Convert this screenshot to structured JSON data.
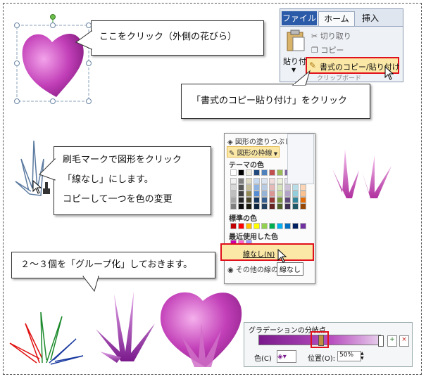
{
  "callouts": {
    "click_outer_petal": "ここをクリック（外側の花びら）",
    "click_format_painter": "「書式のコピー貼り付け」をクリック",
    "brush_line1": "刷毛マークで図形をクリック",
    "brush_line2": "「線なし」にします。",
    "brush_line3": "コピーして一つを色の変更",
    "group_note": "２～３個を「グループ化」しておきます。"
  },
  "ribbon": {
    "tab_file": "ファイル",
    "tab_home": "ホーム",
    "tab_insert": "挿入",
    "paste_label": "貼り付け",
    "cut_label": "切り取り",
    "copy_label": "コピー",
    "format_painter_label": "書式のコピー/貼り付け",
    "clipboard_label": "クリップボード"
  },
  "palette": {
    "shape_fill": "図形の塗りつぶし",
    "shape_outline": "図形の枠線",
    "theme_colors": "テーマの色",
    "standard_colors": "標準の色",
    "recent_colors": "最近使用した色",
    "no_line": "線なし(N)",
    "other_colors": "その他の線の",
    "tooltip": "線なし"
  },
  "gradient": {
    "title": "グラデーションの分岐点",
    "color_label": "色(C)",
    "position_label": "位置(O):",
    "position_value": "50%"
  },
  "colors": {
    "petal_main": "#c23fb8",
    "petal_light": "#f0a6e6",
    "leaf": "#b0309f",
    "highlight_red": "#e0101c",
    "grad_start": "#7a1a8c"
  },
  "theme_palette": [
    [
      "#ffffff",
      "#000000",
      "#eeece1",
      "#1f497d",
      "#4f81bd",
      "#c0504d",
      "#9bbb59",
      "#8064a2",
      "#4bacc6",
      "#f79646"
    ],
    [
      "#f2f2f2",
      "#7f7f7f",
      "#ddd9c3",
      "#c6d9f0",
      "#dbe5f1",
      "#f2dcdb",
      "#ebf1dd",
      "#e5e0ec",
      "#dbeef3",
      "#fdeada"
    ],
    [
      "#d8d8d8",
      "#595959",
      "#c4bd97",
      "#8db3e2",
      "#b8cce4",
      "#e5b9b7",
      "#d7e3bc",
      "#ccc1d9",
      "#b7dde8",
      "#fbd5b5"
    ],
    [
      "#bfbfbf",
      "#3f3f3f",
      "#938953",
      "#548dd4",
      "#95b3d7",
      "#d99694",
      "#c3d69b",
      "#b2a2c7",
      "#92cddc",
      "#fac08f"
    ],
    [
      "#a5a5a5",
      "#262626",
      "#494429",
      "#17365d",
      "#366092",
      "#953734",
      "#76923c",
      "#5f497a",
      "#31859b",
      "#e36c09"
    ],
    [
      "#7f7f7f",
      "#0c0c0c",
      "#1d1b10",
      "#0f243e",
      "#244061",
      "#632423",
      "#4f6128",
      "#3f3151",
      "#205867",
      "#974806"
    ]
  ],
  "standard_palette": [
    "#c00000",
    "#ff0000",
    "#ffc000",
    "#ffff00",
    "#92d050",
    "#00b050",
    "#00b0f0",
    "#0070c0",
    "#002060",
    "#7030a0"
  ],
  "recent_palette": [
    "#cc00aa",
    "#ff66cc",
    "#9999ff"
  ]
}
